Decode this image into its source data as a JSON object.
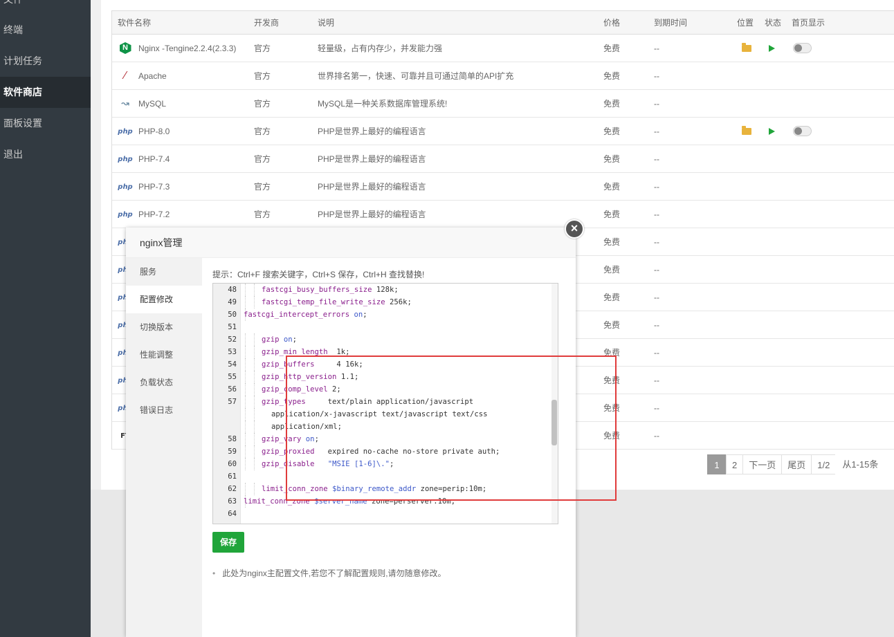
{
  "sidebar": {
    "items": [
      {
        "label": "文件"
      },
      {
        "label": "终端"
      },
      {
        "label": "计划任务"
      },
      {
        "label": "软件商店",
        "active": true
      },
      {
        "label": "面板设置"
      },
      {
        "label": "退出"
      }
    ]
  },
  "table": {
    "headers": {
      "name": "软件名称",
      "dev": "开发商",
      "desc": "说明",
      "price": "价格",
      "expire": "到期时间",
      "location": "位置",
      "status": "状态",
      "home": "首页显示"
    },
    "rows": [
      {
        "icon": "nginx-icon",
        "name": "Nginx -Tengine2.2.4(2.3.3)",
        "dev": "官方",
        "desc": "轻量级，占有内存少，并发能力强",
        "price": "免费",
        "expire": "--",
        "has_controls": true
      },
      {
        "icon": "apache-icon",
        "name": "Apache",
        "dev": "官方",
        "desc": "世界排名第一，快速、可靠并且可通过简单的API扩充",
        "price": "免费",
        "expire": "--",
        "has_controls": false
      },
      {
        "icon": "mysql-icon",
        "name": "MySQL",
        "dev": "官方",
        "desc": "MySQL是一种关系数据库管理系统!",
        "price": "免费",
        "expire": "--",
        "has_controls": false
      },
      {
        "icon": "php-icon",
        "name": "PHP-8.0",
        "dev": "官方",
        "desc": "PHP是世界上最好的编程语言",
        "price": "免费",
        "expire": "--",
        "has_controls": true
      },
      {
        "icon": "php-icon",
        "name": "PHP-7.4",
        "dev": "官方",
        "desc": "PHP是世界上最好的编程语言",
        "price": "免费",
        "expire": "--",
        "has_controls": false
      },
      {
        "icon": "php-icon",
        "name": "PHP-7.3",
        "dev": "官方",
        "desc": "PHP是世界上最好的编程语言",
        "price": "免费",
        "expire": "--",
        "has_controls": false
      },
      {
        "icon": "php-icon",
        "name": "PHP-7.2",
        "dev": "官方",
        "desc": "PHP是世界上最好的编程语言",
        "price": "免费",
        "expire": "--",
        "has_controls": false
      },
      {
        "icon": "php-icon",
        "name": "",
        "dev": "",
        "desc": "",
        "price": "免费",
        "expire": "--",
        "has_controls": false
      },
      {
        "icon": "php-icon",
        "name": "",
        "dev": "",
        "desc": "",
        "price": "免费",
        "expire": "--",
        "has_controls": false
      },
      {
        "icon": "php-icon",
        "name": "",
        "dev": "",
        "desc": "",
        "price": "免费",
        "expire": "--",
        "has_controls": false
      },
      {
        "icon": "php-icon",
        "name": "",
        "dev": "",
        "desc": "",
        "price": "免费",
        "expire": "--",
        "has_controls": false
      },
      {
        "icon": "php-icon",
        "name": "",
        "dev": "",
        "desc": "",
        "price": "免费",
        "expire": "--",
        "has_controls": false
      },
      {
        "icon": "php-icon",
        "name": "",
        "dev": "",
        "desc": "",
        "price": "免费",
        "expire": "--",
        "has_controls": false
      },
      {
        "icon": "php-icon",
        "name": "",
        "dev": "",
        "desc": "",
        "price": "免费",
        "expire": "--",
        "has_controls": false
      },
      {
        "icon": "ftp-icon",
        "name": "",
        "dev": "",
        "desc": "",
        "price": "免费",
        "expire": "--",
        "has_controls": false
      }
    ]
  },
  "pagination": {
    "pages": [
      "1",
      "2"
    ],
    "current": "1",
    "next": "下一页",
    "last": "尾页",
    "page_of": "1/2",
    "range": "从1-15条"
  },
  "modal": {
    "title": "nginx管理",
    "tabs": [
      "服务",
      "配置修改",
      "切换版本",
      "性能调整",
      "负载状态",
      "错误日志"
    ],
    "active_tab": "配置修改",
    "hint": "提示：Ctrl+F 搜索关键字，Ctrl+S 保存，Ctrl+H 查找替换!",
    "save_label": "保存",
    "tip": "此处为nginx主配置文件,若您不了解配置规则,请勿随意修改。",
    "code_lines": [
      {
        "num": "48",
        "indent": 2,
        "parts": [
          [
            "kw",
            "fastcgi_busy_buffers_size"
          ],
          [
            "",
            " 128k;"
          ]
        ]
      },
      {
        "num": "49",
        "indent": 2,
        "parts": [
          [
            "kw",
            "fastcgi_temp_file_write_size"
          ],
          [
            "",
            " 256k;"
          ]
        ]
      },
      {
        "num": "50",
        "indent": 1,
        "parts": [
          [
            "kw",
            "fastcgi_intercept_errors"
          ],
          [
            "",
            " "
          ],
          [
            "vl",
            "on"
          ],
          [
            "",
            ";"
          ]
        ]
      },
      {
        "num": "51",
        "indent": 0,
        "parts": []
      },
      {
        "num": "52",
        "indent": 2,
        "parts": [
          [
            "kw",
            "gzip"
          ],
          [
            "",
            " "
          ],
          [
            "vl",
            "on"
          ],
          [
            "",
            ";"
          ]
        ]
      },
      {
        "num": "53",
        "indent": 2,
        "parts": [
          [
            "kw",
            "gzip_min_length"
          ],
          [
            "",
            "  1k;"
          ]
        ]
      },
      {
        "num": "54",
        "indent": 2,
        "parts": [
          [
            "kw",
            "gzip_buffers"
          ],
          [
            "",
            "     4 16k;"
          ]
        ]
      },
      {
        "num": "55",
        "indent": 2,
        "parts": [
          [
            "kw",
            "gzip_http_version"
          ],
          [
            "",
            " 1.1;"
          ]
        ]
      },
      {
        "num": "56",
        "indent": 2,
        "parts": [
          [
            "kw",
            "gzip_comp_level"
          ],
          [
            "",
            " 2;"
          ]
        ]
      },
      {
        "num": "57",
        "indent": 2,
        "parts": [
          [
            "kw",
            "gzip_types"
          ],
          [
            "",
            "     text/plain application/javascript"
          ]
        ]
      },
      {
        "num": "",
        "indent": 3,
        "parts": [
          [
            "",
            "application/x-javascript text/javascript text/css"
          ]
        ]
      },
      {
        "num": "",
        "indent": 3,
        "parts": [
          [
            "",
            "application/xml;"
          ]
        ]
      },
      {
        "num": "58",
        "indent": 2,
        "parts": [
          [
            "kw",
            "gzip_vary"
          ],
          [
            "",
            " "
          ],
          [
            "vl",
            "on"
          ],
          [
            "",
            ";"
          ]
        ]
      },
      {
        "num": "59",
        "indent": 2,
        "parts": [
          [
            "kw",
            "gzip_proxied"
          ],
          [
            "",
            "   expired no-cache no-store private auth;"
          ]
        ]
      },
      {
        "num": "60",
        "indent": 2,
        "parts": [
          [
            "kw",
            "gzip_disable"
          ],
          [
            "",
            "   "
          ],
          [
            "st",
            "\"MSIE [1-6]\\.\""
          ],
          [
            "",
            ";"
          ]
        ]
      },
      {
        "num": "61",
        "indent": 0,
        "parts": []
      },
      {
        "num": "62",
        "indent": 2,
        "parts": [
          [
            "kw",
            "limit_conn_zone"
          ],
          [
            "",
            " "
          ],
          [
            "vl",
            "$binary_remote_addr"
          ],
          [
            "",
            " zone=perip:10m;"
          ]
        ]
      },
      {
        "num": "63",
        "indent": 1,
        "parts": [
          [
            "kw",
            "limit_conn_zone"
          ],
          [
            "",
            " "
          ],
          [
            "vl",
            "$server_name"
          ],
          [
            "",
            " zone=perserver:10m;"
          ]
        ]
      },
      {
        "num": "64",
        "indent": 0,
        "parts": []
      }
    ]
  }
}
